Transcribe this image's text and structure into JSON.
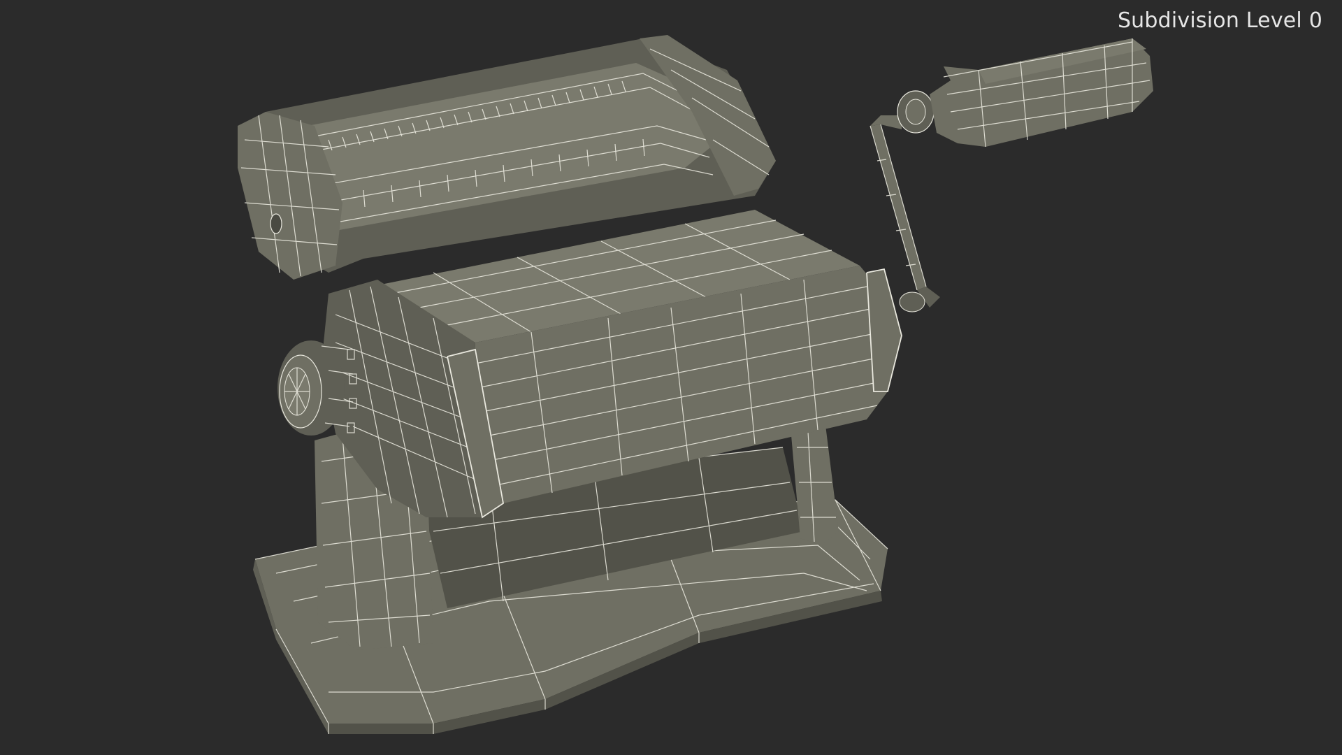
{
  "viewport": {
    "overlay_label": "Subdivision Level 0",
    "background_color": "#2b2b2b",
    "mesh_color": "#6f6f63",
    "wireframe_color": "#e9e8de"
  },
  "model": {
    "parts": [
      "rear-roller-housing",
      "front-roller-housing",
      "adjustment-knob",
      "crank-handle",
      "base-plate",
      "support-legs"
    ]
  }
}
